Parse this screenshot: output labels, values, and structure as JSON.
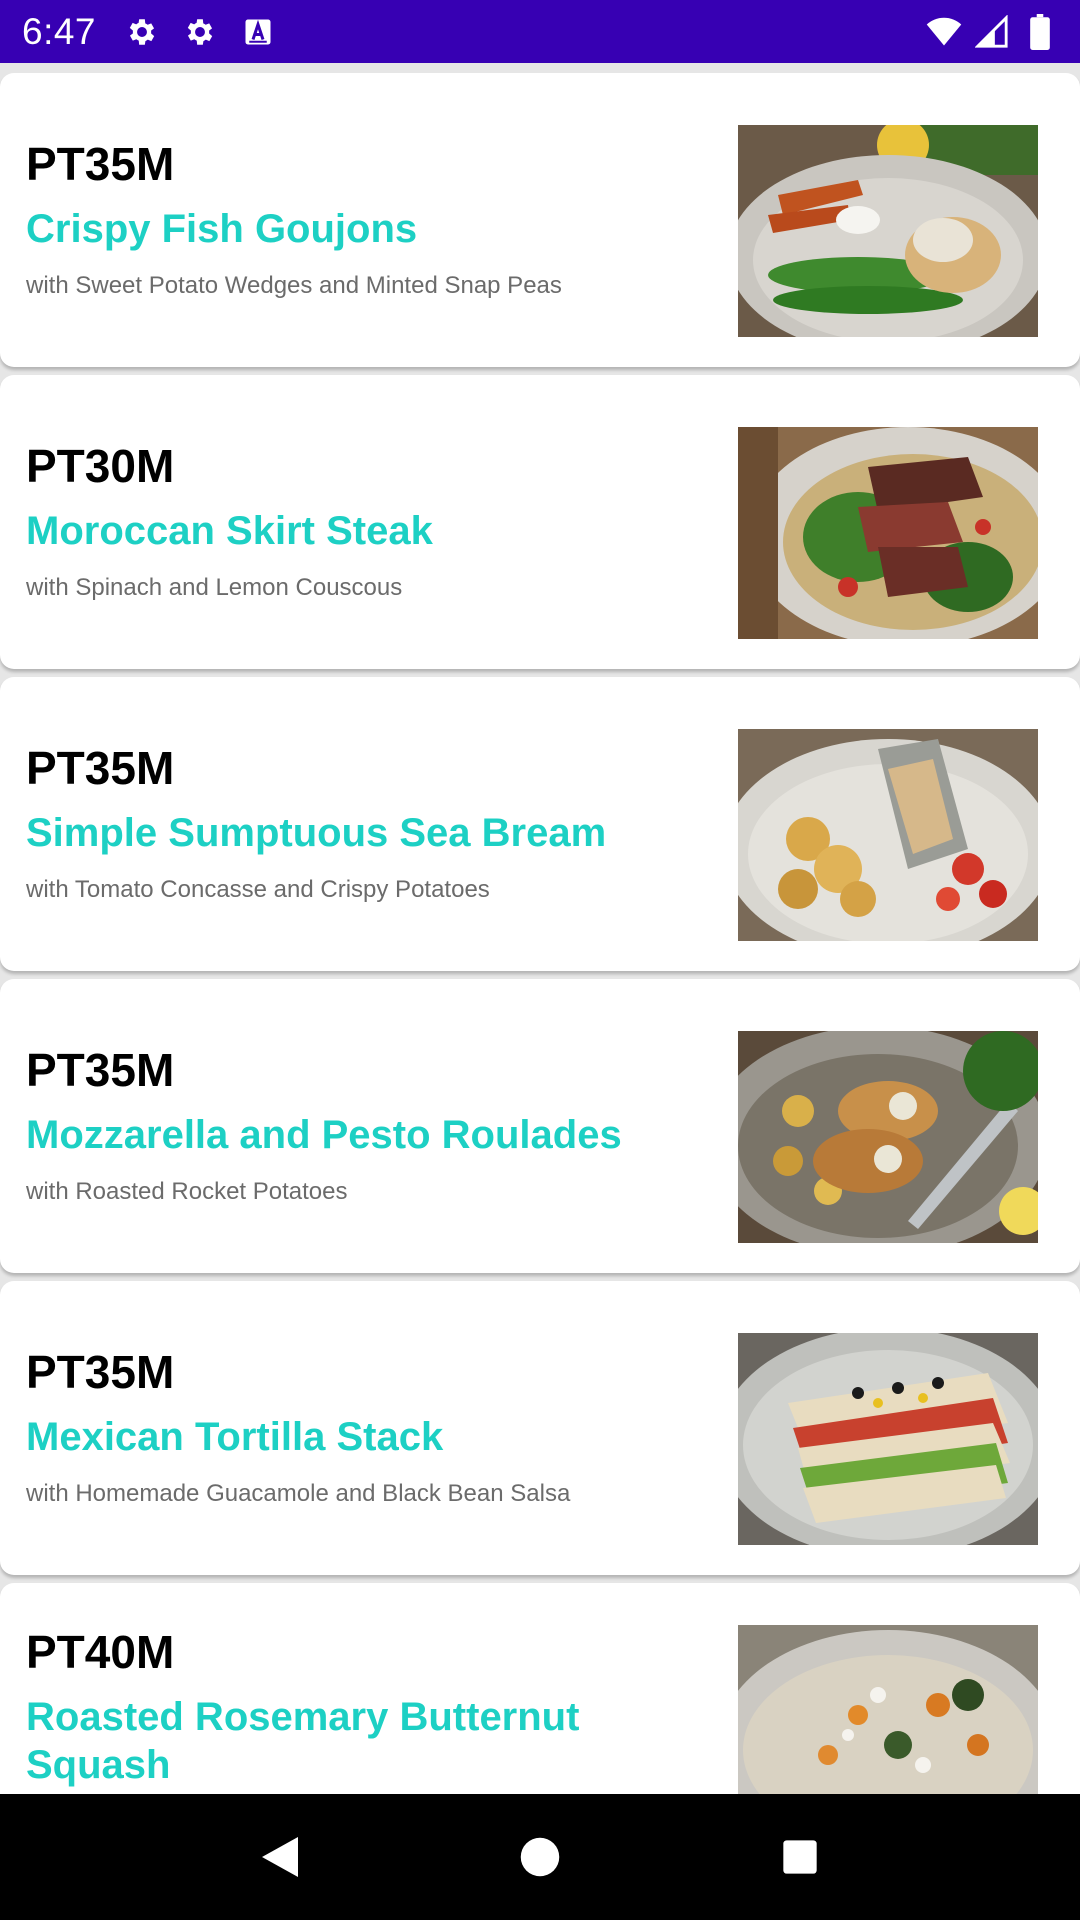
{
  "status_bar": {
    "time": "6:47",
    "left_icons": [
      "gear-icon",
      "gear-icon",
      "keyboard-a-icon"
    ],
    "right_icons": [
      "wifi-icon",
      "cell-signal-icon",
      "battery-icon"
    ],
    "background": "#3700b3"
  },
  "recipes": [
    {
      "time": "PT35M",
      "title": "Crispy Fish Goujons",
      "subtitle": "with Sweet Potato Wedges and Minted Snap Peas",
      "image": "fish-goujons-photo"
    },
    {
      "time": "PT30M",
      "title": "Moroccan Skirt Steak",
      "subtitle": "with Spinach and Lemon Couscous",
      "image": "skirt-steak-photo"
    },
    {
      "time": "PT35M",
      "title": "Simple Sumptuous Sea Bream",
      "subtitle": "with Tomato Concasse and Crispy Potatoes",
      "image": "sea-bream-photo"
    },
    {
      "time": "PT35M",
      "title": "Mozzarella and Pesto Roulades",
      "subtitle": "with Roasted Rocket Potatoes",
      "image": "roulades-photo"
    },
    {
      "time": "PT35M",
      "title": "Mexican Tortilla Stack",
      "subtitle": "with Homemade Guacamole and Black Bean Salsa",
      "image": "tortilla-stack-photo"
    },
    {
      "time": "PT40M",
      "title": "Roasted Rosemary Butternut Squash",
      "subtitle": "",
      "image": "butternut-squash-photo"
    }
  ],
  "colors": {
    "title_accent": "#1dd0c4",
    "time_text": "#000000",
    "subtitle_text": "#6b6b6b"
  },
  "nav_bar": {
    "buttons": [
      "back-icon",
      "home-icon",
      "recents-icon"
    ]
  }
}
